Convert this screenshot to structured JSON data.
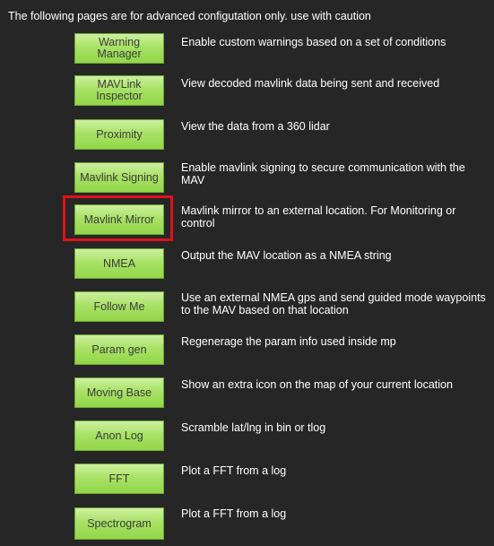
{
  "header": {
    "text": "The following pages are for advanced configutation only. use with caution"
  },
  "items": [
    {
      "label": "Warning Manager",
      "description": "Enable custom warnings based on a set of conditions"
    },
    {
      "label": "MAVLink Inspector",
      "description": "View decoded mavlink data being sent and received"
    },
    {
      "label": "Proximity",
      "description": "View the data from a 360 lidar"
    },
    {
      "label": "Mavlink Signing",
      "description": "Enable mavlink signing to secure communication with the MAV"
    },
    {
      "label": "Mavlink Mirror",
      "description": "Mavlink mirror to an external location. For Monitoring or control"
    },
    {
      "label": "NMEA",
      "description": "Output the MAV location as a NMEA string"
    },
    {
      "label": "Follow Me",
      "description": "Use an external NMEA gps and send guided mode waypoints to the MAV based on that location"
    },
    {
      "label": "Param gen",
      "description": "Regenerage the param info used inside mp"
    },
    {
      "label": "Moving Base",
      "description": "Show an extra icon on the map of your current location"
    },
    {
      "label": "Anon Log",
      "description": "Scramble lat/lng in bin or tlog"
    },
    {
      "label": "FFT",
      "description": "Plot a FFT from a log"
    },
    {
      "label": "Spectrogram",
      "description": "Plot a FFT from a log"
    }
  ],
  "colors": {
    "background": "#262626",
    "button_green": "#a9e266",
    "highlight_red": "#e0101a"
  }
}
